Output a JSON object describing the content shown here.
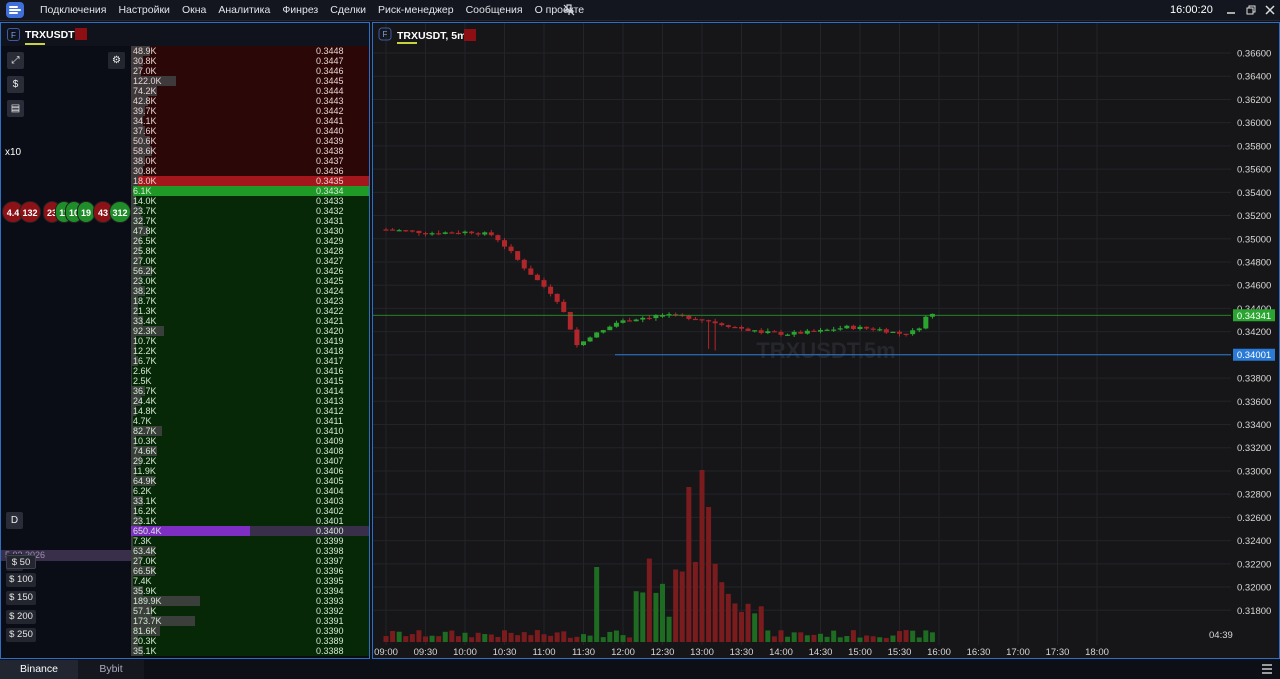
{
  "menu": [
    "Подключения",
    "Настройки",
    "Окна",
    "Аналитика",
    "Финрез",
    "Сделки",
    "Риск-менеджер",
    "Сообщения",
    "О проекте"
  ],
  "clock": "16:00:20",
  "left": {
    "symbol": "TRXUSDT",
    "badge": "F",
    "multiplier": "x10",
    "d_label": "D",
    "date_partial": "5.03.2026",
    "quantities": [
      "$ 50",
      "$ 100",
      "$ 150",
      "$ 200",
      "$ 250"
    ],
    "bubbles": [
      "4.4",
      "132",
      "23",
      "11",
      "10",
      "19",
      "43",
      "312"
    ]
  },
  "orderbook": {
    "asks": [
      {
        "v": "48.9K",
        "p": "0.3448",
        "r": 0.08
      },
      {
        "v": "30.8K",
        "p": "0.3447",
        "r": 0.05
      },
      {
        "v": "27.0K",
        "p": "0.3446",
        "r": 0.04
      },
      {
        "v": "122.0K",
        "p": "0.3445",
        "r": 0.19
      },
      {
        "v": "74.2K",
        "p": "0.3444",
        "r": 0.11
      },
      {
        "v": "42.8K",
        "p": "0.3443",
        "r": 0.07
      },
      {
        "v": "39.7K",
        "p": "0.3442",
        "r": 0.06
      },
      {
        "v": "34.1K",
        "p": "0.3441",
        "r": 0.05
      },
      {
        "v": "37.6K",
        "p": "0.3440",
        "r": 0.06
      },
      {
        "v": "50.6K",
        "p": "0.3439",
        "r": 0.08
      },
      {
        "v": "58.6K",
        "p": "0.3438",
        "r": 0.09
      },
      {
        "v": "38.0K",
        "p": "0.3437",
        "r": 0.06
      },
      {
        "v": "30.8K",
        "p": "0.3436",
        "r": 0.05
      },
      {
        "v": "18.0K",
        "p": "0.3435",
        "r": 0.03
      }
    ],
    "bids": [
      {
        "v": "6.1K",
        "p": "0.3434",
        "r": 0.01
      },
      {
        "v": "14.0K",
        "p": "0.3433",
        "r": 0.02
      },
      {
        "v": "23.7K",
        "p": "0.3432",
        "r": 0.04
      },
      {
        "v": "32.7K",
        "p": "0.3431",
        "r": 0.05
      },
      {
        "v": "47.8K",
        "p": "0.3430",
        "r": 0.07
      },
      {
        "v": "26.5K",
        "p": "0.3429",
        "r": 0.04
      },
      {
        "v": "25.8K",
        "p": "0.3428",
        "r": 0.04
      },
      {
        "v": "27.0K",
        "p": "0.3427",
        "r": 0.04
      },
      {
        "v": "56.2K",
        "p": "0.3426",
        "r": 0.09
      },
      {
        "v": "23.0K",
        "p": "0.3425",
        "r": 0.04
      },
      {
        "v": "38.2K",
        "p": "0.3424",
        "r": 0.06
      },
      {
        "v": "18.7K",
        "p": "0.3423",
        "r": 0.03
      },
      {
        "v": "21.3K",
        "p": "0.3422",
        "r": 0.03
      },
      {
        "v": "33.4K",
        "p": "0.3421",
        "r": 0.05
      },
      {
        "v": "92.3K",
        "p": "0.3420",
        "r": 0.14
      },
      {
        "v": "10.7K",
        "p": "0.3419",
        "r": 0.02
      },
      {
        "v": "12.2K",
        "p": "0.3418",
        "r": 0.02
      },
      {
        "v": "16.7K",
        "p": "0.3417",
        "r": 0.03
      },
      {
        "v": "2.6K",
        "p": "0.3416",
        "r": 0.005
      },
      {
        "v": "2.5K",
        "p": "0.3415",
        "r": 0.005
      },
      {
        "v": "36.7K",
        "p": "0.3414",
        "r": 0.06
      },
      {
        "v": "24.4K",
        "p": "0.3413",
        "r": 0.04
      },
      {
        "v": "14.8K",
        "p": "0.3412",
        "r": 0.02
      },
      {
        "v": "4.7K",
        "p": "0.3411",
        "r": 0.01
      },
      {
        "v": "82.7K",
        "p": "0.3410",
        "r": 0.13
      },
      {
        "v": "10.3K",
        "p": "0.3409",
        "r": 0.02
      },
      {
        "v": "74.6K",
        "p": "0.3408",
        "r": 0.11
      },
      {
        "v": "29.2K",
        "p": "0.3407",
        "r": 0.04
      },
      {
        "v": "11.9K",
        "p": "0.3406",
        "r": 0.02
      },
      {
        "v": "64.9K",
        "p": "0.3405",
        "r": 0.1
      },
      {
        "v": "6.2K",
        "p": "0.3404",
        "r": 0.01
      },
      {
        "v": "33.1K",
        "p": "0.3403",
        "r": 0.05
      },
      {
        "v": "16.2K",
        "p": "0.3402",
        "r": 0.02
      },
      {
        "v": "23.1K",
        "p": "0.3401",
        "r": 0.04
      },
      {
        "v": "650.4K",
        "p": "0.3400",
        "r": 0.5,
        "hl": true
      },
      {
        "v": "7.3K",
        "p": "0.3399",
        "r": 0.01
      },
      {
        "v": "63.4K",
        "p": "0.3398",
        "r": 0.1
      },
      {
        "v": "27.0K",
        "p": "0.3397",
        "r": 0.04
      },
      {
        "v": "66.5K",
        "p": "0.3396",
        "r": 0.1
      },
      {
        "v": "7.4K",
        "p": "0.3395",
        "r": 0.01
      },
      {
        "v": "35.9K",
        "p": "0.3394",
        "r": 0.05
      },
      {
        "v": "189.9K",
        "p": "0.3393",
        "r": 0.29
      },
      {
        "v": "57.1K",
        "p": "0.3392",
        "r": 0.09
      },
      {
        "v": "173.7K",
        "p": "0.3391",
        "r": 0.27
      },
      {
        "v": "81.6K",
        "p": "0.3390",
        "r": 0.12
      },
      {
        "v": "20.3K",
        "p": "0.3389",
        "r": 0.03
      },
      {
        "v": "35.1K",
        "p": "0.3388",
        "r": 0.05
      }
    ]
  },
  "chart": {
    "title": "TRXUSDT, 5m",
    "badge": "F",
    "price_ticks": [
      "0.36600",
      "0.36400",
      "0.36200",
      "0.36000",
      "0.35800",
      "0.35600",
      "0.35400",
      "0.35200",
      "0.35000",
      "0.34800",
      "0.34600",
      "0.34400",
      "0.34200",
      "0.34000",
      "0.33800",
      "0.33600",
      "0.33400",
      "0.33200",
      "0.33000",
      "0.32800",
      "0.32600",
      "0.32400",
      "0.32200",
      "0.32000",
      "0.31800"
    ],
    "time_ticks": [
      "09:00",
      "09:30",
      "10:00",
      "10:30",
      "11:00",
      "11:30",
      "12:00",
      "12:30",
      "13:00",
      "13:30",
      "14:00",
      "14:30",
      "15:00",
      "15:30",
      "16:00",
      "16:30",
      "17:00",
      "17:30",
      "18:00"
    ],
    "last_price": "0.34341",
    "level_price": "0.34001",
    "countdown": "04:39",
    "watermark": "TRXUSDT.5m",
    "colors": {
      "up": "#2aa530",
      "down": "#b0262a",
      "vol_up": "#1e6c22",
      "vol_down": "#7a1b1e",
      "last": "#2aa530",
      "level": "#2a7ad8"
    }
  },
  "bottom": {
    "tabs": [
      "Binance",
      "Bybit"
    ]
  }
}
